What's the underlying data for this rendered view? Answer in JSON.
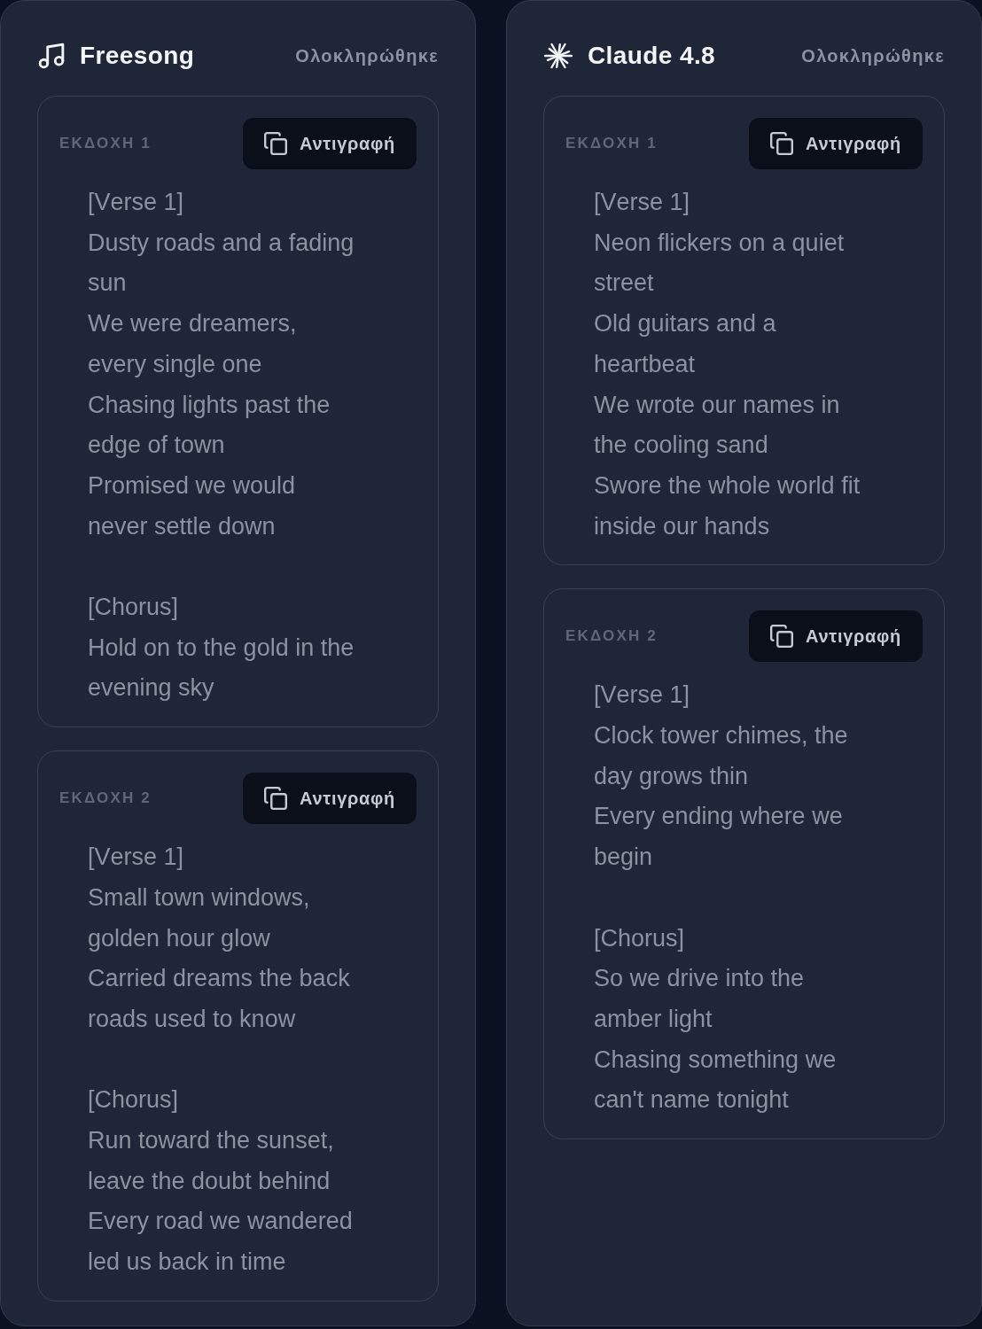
{
  "panels": [
    {
      "kind": "music",
      "title": "Freesong",
      "status": "Ολοκληρώθηκε",
      "versions": [
        {
          "label": "ΕΚΔΟΧΗ 1",
          "copy_label": "Αντιγραφή",
          "stanzas": [
            {
              "tag": "[Verse 1]",
              "lines": [
                "Dusty roads and a fading sun",
                "We were dreamers, every single one",
                "Chasing lights past the edge of town",
                "Promised we would never settle down"
              ]
            },
            {
              "tag": "[Chorus]",
              "lines": [
                "Hold on to the gold in the evening sky"
              ]
            }
          ]
        },
        {
          "label": "ΕΚΔΟΧΗ 2",
          "copy_label": "Αντιγραφή",
          "stanzas": [
            {
              "tag": "[Verse 1]",
              "lines": [
                "Small town windows, golden hour glow",
                "Carried dreams the back roads used to know"
              ]
            },
            {
              "tag": "[Chorus]",
              "lines": [
                "Run toward the sunset, leave the doubt behind",
                "Every road we wandered led us back in time"
              ]
            }
          ]
        }
      ]
    },
    {
      "kind": "burst",
      "title": "Claude 4.8",
      "status": "Ολοκληρώθηκε",
      "versions": [
        {
          "label": "ΕΚΔΟΧΗ 1",
          "copy_label": "Αντιγραφή",
          "stanzas": [
            {
              "tag": "[Verse 1]",
              "lines": [
                "Neon flickers on a quiet street",
                "Old guitars and a heartbeat",
                "We wrote our names in the cooling sand",
                "Swore the whole world fit inside our hands"
              ]
            }
          ]
        },
        {
          "label": "ΕΚΔΟΧΗ 2",
          "copy_label": "Αντιγραφή",
          "stanzas": [
            {
              "tag": "[Verse 1]",
              "lines": [
                "Clock tower chimes, the day grows thin",
                "Every ending where we begin"
              ]
            },
            {
              "tag": "[Chorus]",
              "lines": [
                "So we drive into the amber light",
                "Chasing something we can't name tonight"
              ]
            }
          ]
        }
      ]
    }
  ]
}
